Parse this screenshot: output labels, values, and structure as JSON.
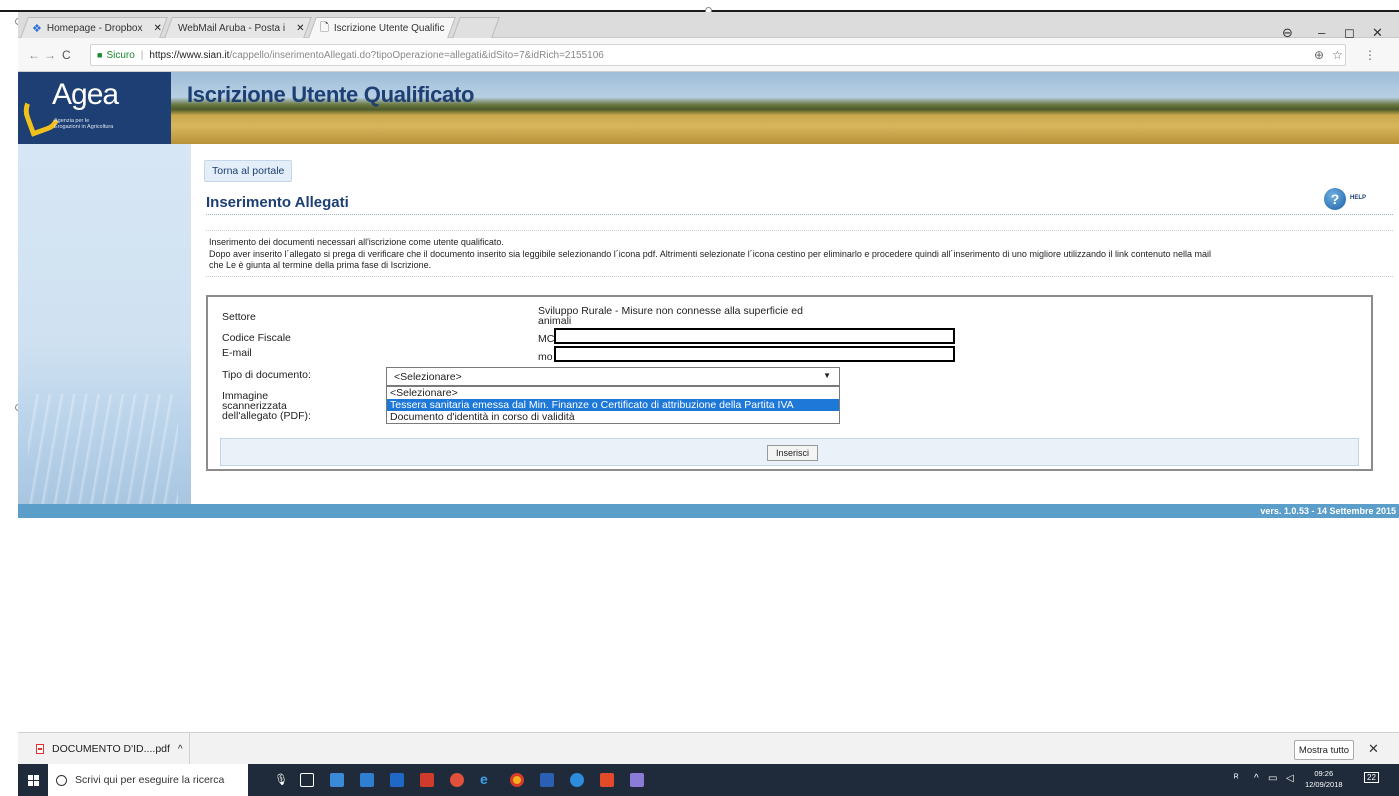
{
  "browser": {
    "tabs": [
      {
        "title": "Homepage - Dropbox"
      },
      {
        "title": "WebMail Aruba - Posta i"
      },
      {
        "title": "Iscrizione Utente Qualific"
      }
    ],
    "address": {
      "secure_label": "Sicuro",
      "url_host": "https://www.sian.it",
      "url_path": "/cappello/inserimentoAllegati.do?tipoOperazione=allegati&idSito=7&idRich=2155106"
    }
  },
  "banner": {
    "logo_text": "Agea",
    "logo_sub": "Agenzia per le Erogazioni in Agricoltura",
    "title": "Iscrizione Utente Qualificato"
  },
  "page": {
    "portal_button": "Torna al portale",
    "section_title": "Inserimento Allegati",
    "help_label": "HELP",
    "info_line1": "Inserimento dei documenti necessari all'iscrizione come utente qualificato.",
    "info_line2": "Dopo aver inserito l´allegato si prega di verificare che il documento inserito sia leggibile selezionando l´icona pdf. Altrimenti selezionate l´icona cestino per eliminarlo e procedere quindi all´inserimento di uno migliore utilizzando il link contenuto nella mail",
    "info_line3": "che Le è giunta al termine della prima fase di Iscrizione."
  },
  "form": {
    "settore_label": "Settore",
    "settore_value": "Sviluppo Rurale - Misure non connesse alla superficie ed animali",
    "cf_label": "Codice Fiscale",
    "cf_value": "MC",
    "email_label": "E-mail",
    "email_value": "mo",
    "tipo_label": "Tipo di documento:",
    "tipo_selected": "<Selezionare>",
    "tipo_options": [
      "<Selezionare>",
      "Tessera sanitaria emessa dal Min. Finanze o Certificato di attribuzione della Partita IVA",
      "Documento d'identità in corso di validità"
    ],
    "immagine_label": "Immagine scannerizzata dell'allegato (PDF):",
    "submit_label": "Inserisci"
  },
  "footer": {
    "version": "vers. 1.0.53 - 14 Settembre 2015"
  },
  "downloads": {
    "file": "DOCUMENTO D'ID....pdf",
    "show_all": "Mostra tutto"
  },
  "taskbar": {
    "search_placeholder": "Scrivi qui per eseguire la ricerca",
    "time": "09:26",
    "date": "12/09/2018",
    "notif_count": "22"
  },
  "colors": {
    "brand_blue": "#1d3f73",
    "footer_blue": "#5a9ec9",
    "selected_option": "#1e78d8"
  }
}
